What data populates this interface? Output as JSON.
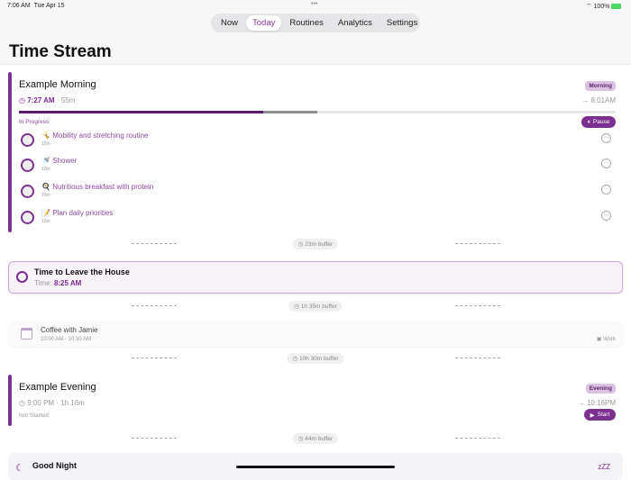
{
  "status_bar": {
    "time": "7:06 AM",
    "date": "Tue Apr 15",
    "battery": "100%"
  },
  "tabs": [
    {
      "label": "Now"
    },
    {
      "label": "Today"
    },
    {
      "label": "Routines"
    },
    {
      "label": "Analytics"
    },
    {
      "label": "Settings"
    }
  ],
  "page_title": "Time Stream",
  "morning": {
    "title": "Example Morning",
    "badge": "Morning",
    "start": "7:27 AM",
    "duration": "55m",
    "end": "→ 8:01AM",
    "status": "In Progress",
    "pause": "Pause",
    "progress_complete": 0.41,
    "progress_elapsed": 0.5,
    "tasks": [
      {
        "icon": "🤸",
        "name": "Mobility and stretching routine",
        "dur": "15m"
      },
      {
        "icon": "🚿",
        "name": "Shower",
        "dur": "10m"
      },
      {
        "icon": "🍳",
        "name": "Nutritious breakfast with protein",
        "dur": "20m"
      },
      {
        "icon": "📝",
        "name": "Plan daily priorities",
        "dur": "10m"
      }
    ]
  },
  "buffers": [
    "23m buffer",
    "1h 35m buffer",
    "10h 30m buffer",
    "44m buffer"
  ],
  "leave": {
    "title": "Time to Leave the House",
    "time_label": "Time:",
    "time": "8:25 AM"
  },
  "coffee": {
    "title": "Coffee with Jamie",
    "time": "10:00 AM - 10:30 AM",
    "calendar": "Work"
  },
  "evening": {
    "title": "Example Evening",
    "badge": "Evening",
    "start": "9:00 PM",
    "duration": "1h 16m",
    "end": "→ 10:16PM",
    "status": "Not Started",
    "start_btn": "Start"
  },
  "goodnight": {
    "title": "Good Night",
    "zzz": "zZZ"
  }
}
